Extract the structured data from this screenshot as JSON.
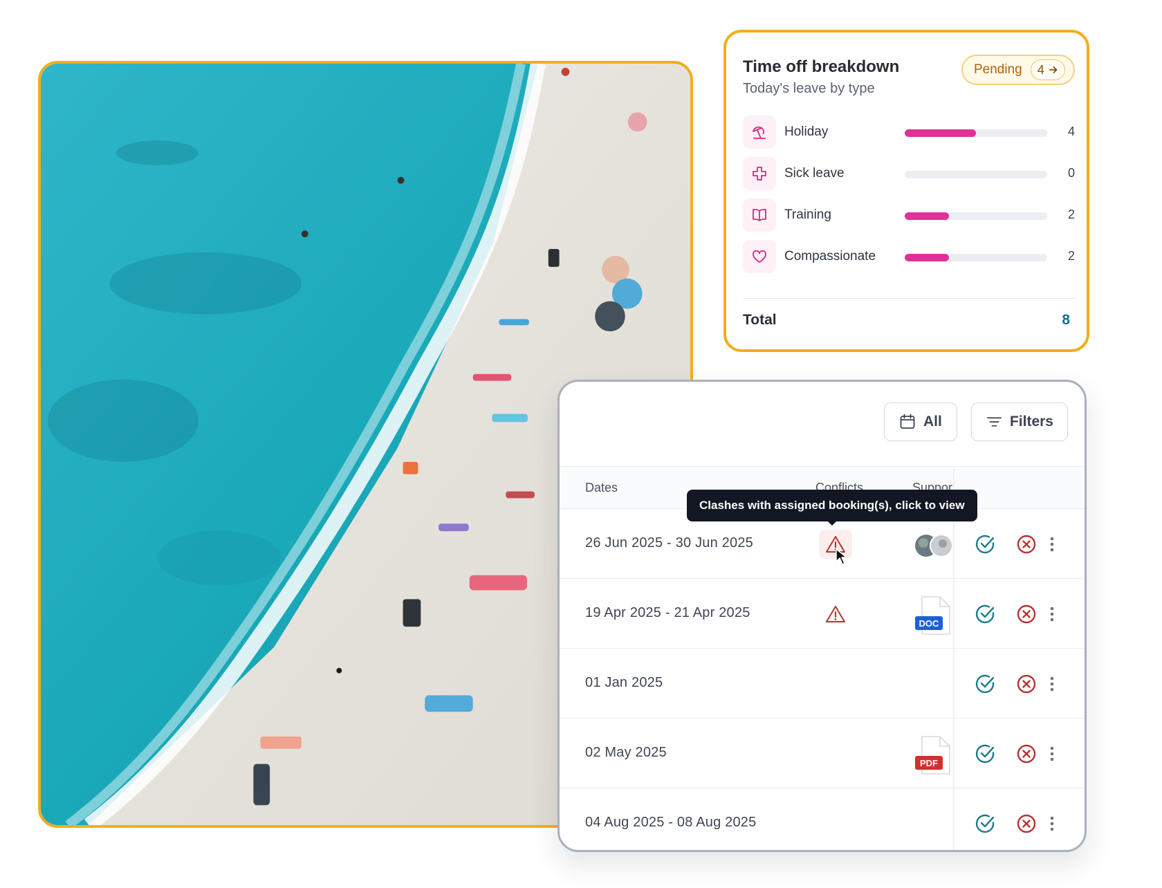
{
  "photo": {
    "icon": "beach-photo"
  },
  "time_off": {
    "title": "Time off breakdown",
    "subtitle": "Today's leave by type",
    "pending": {
      "label": "Pending",
      "count": "4"
    },
    "rows": [
      {
        "label": "Holiday",
        "value": "4",
        "fraction": 0.5,
        "icon": "beach-umbrella-icon"
      },
      {
        "label": "Sick leave",
        "value": "0",
        "fraction": 0,
        "icon": "medical-cross-icon"
      },
      {
        "label": "Training",
        "value": "2",
        "fraction": 0.31,
        "icon": "book-icon"
      },
      {
        "label": "Compassionate",
        "value": "2",
        "fraction": 0.31,
        "icon": "heart-icon"
      }
    ],
    "total_label": "Total",
    "total_value": "8",
    "accent": "#e1309a"
  },
  "requests": {
    "toolbar": {
      "all_label": "All",
      "filters_label": "Filters"
    },
    "columns": {
      "dates": "Dates",
      "conflicts": "Conflicts",
      "support": "Suppor"
    },
    "tooltip": "Clashes with assigned booking(s), click to view",
    "rows": [
      {
        "dates": "26 Jun 2025 - 30 Jun 2025",
        "conflict": true,
        "support": "avatars"
      },
      {
        "dates": "19 Apr 2025 - 21 Apr 2025",
        "conflict": true,
        "support": "DOC"
      },
      {
        "dates": "01 Jan 2025",
        "conflict": false,
        "support": ""
      },
      {
        "dates": "02 May 2025",
        "conflict": false,
        "support": "PDF"
      },
      {
        "dates": "04 Aug 2025 - 08 Aug 2025",
        "conflict": false,
        "support": ""
      }
    ]
  }
}
